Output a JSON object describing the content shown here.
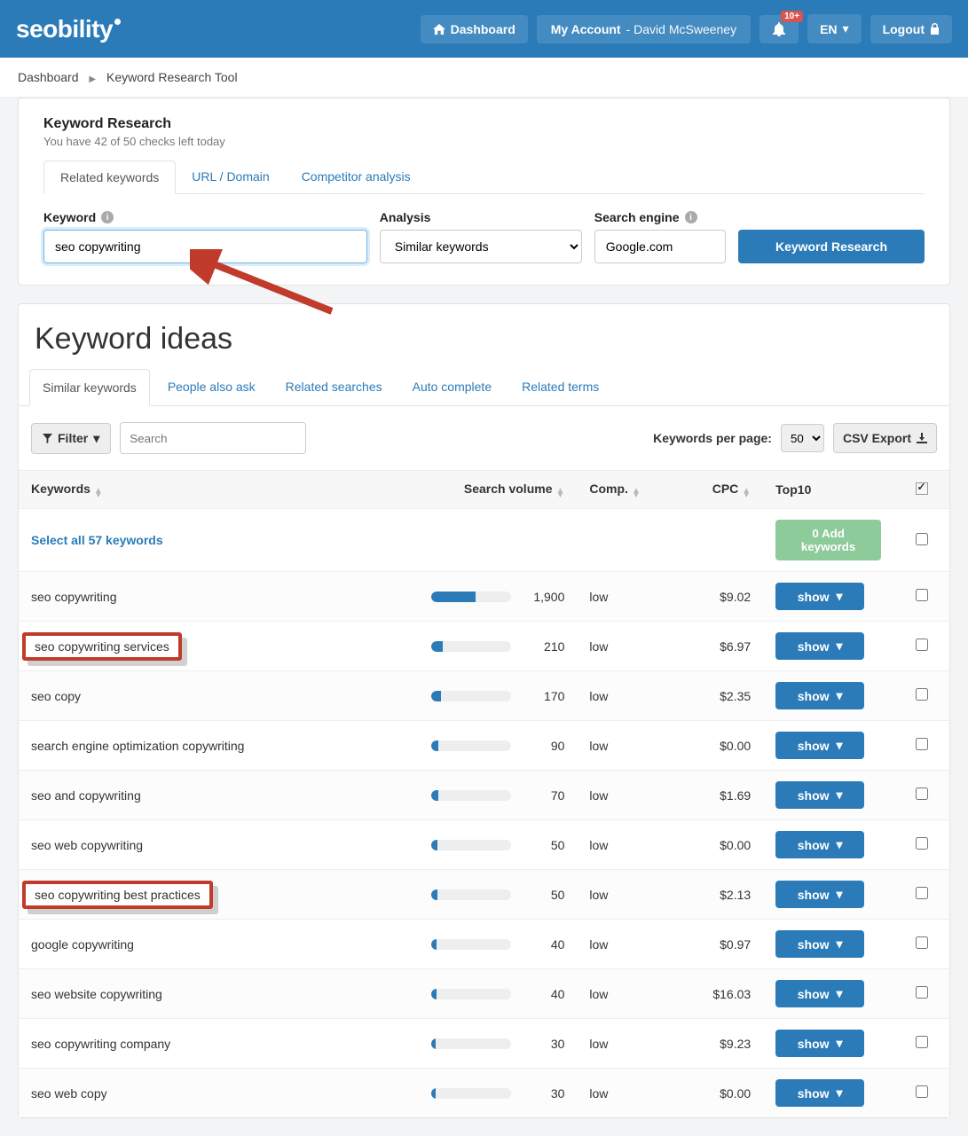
{
  "topbar": {
    "logo": "seobility",
    "dashboard": "Dashboard",
    "account_label": "My Account",
    "account_user": "David McSweeney",
    "notif_badge": "10+",
    "lang": "EN",
    "logout": "Logout"
  },
  "breadcrumb": {
    "a": "Dashboard",
    "b": "Keyword Research Tool"
  },
  "panel": {
    "title": "Keyword Research",
    "sub": "You have 42 of 50 checks left today",
    "tabs": [
      "Related keywords",
      "URL / Domain",
      "Competitor analysis"
    ],
    "keyword_label": "Keyword",
    "keyword_value": "seo copywriting",
    "analysis_label": "Analysis",
    "analysis_value": "Similar keywords",
    "engine_label": "Search engine",
    "engine_value": "Google.com",
    "button": "Keyword Research"
  },
  "ideas": {
    "heading": "Keyword ideas",
    "tabs": [
      "Similar keywords",
      "People also ask",
      "Related searches",
      "Auto complete",
      "Related terms"
    ],
    "filter": "Filter",
    "search_placeholder": "Search",
    "kpp_label": "Keywords per page:",
    "kpp_value": "50",
    "csv": "CSV Export",
    "cols": {
      "kw": "Keywords",
      "sv": "Search volume",
      "comp": "Comp.",
      "cpc": "CPC",
      "top10": "Top10"
    },
    "selectall": "Select all 57 keywords",
    "addkw": "0 Add keywords",
    "show": "show",
    "rows": [
      {
        "kw": "seo copywriting",
        "sv": "1,900",
        "bar": 55,
        "comp": "low",
        "cpc": "$9.02",
        "hl": false
      },
      {
        "kw": "seo copywriting services",
        "sv": "210",
        "bar": 14,
        "comp": "low",
        "cpc": "$6.97",
        "hl": true
      },
      {
        "kw": "seo copy",
        "sv": "170",
        "bar": 12,
        "comp": "low",
        "cpc": "$2.35",
        "hl": false
      },
      {
        "kw": "search engine optimization copywriting",
        "sv": "90",
        "bar": 9,
        "comp": "low",
        "cpc": "$0.00",
        "hl": false
      },
      {
        "kw": "seo and copywriting",
        "sv": "70",
        "bar": 8,
        "comp": "low",
        "cpc": "$1.69",
        "hl": false
      },
      {
        "kw": "seo web copywriting",
        "sv": "50",
        "bar": 7,
        "comp": "low",
        "cpc": "$0.00",
        "hl": false
      },
      {
        "kw": "seo copywriting best practices",
        "sv": "50",
        "bar": 7,
        "comp": "low",
        "cpc": "$2.13",
        "hl": true
      },
      {
        "kw": "google copywriting",
        "sv": "40",
        "bar": 6,
        "comp": "low",
        "cpc": "$0.97",
        "hl": false
      },
      {
        "kw": "seo website copywriting",
        "sv": "40",
        "bar": 6,
        "comp": "low",
        "cpc": "$16.03",
        "hl": false
      },
      {
        "kw": "seo copywriting company",
        "sv": "30",
        "bar": 5,
        "comp": "low",
        "cpc": "$9.23",
        "hl": false
      },
      {
        "kw": "seo web copy",
        "sv": "30",
        "bar": 5,
        "comp": "low",
        "cpc": "$0.00",
        "hl": false
      }
    ]
  }
}
